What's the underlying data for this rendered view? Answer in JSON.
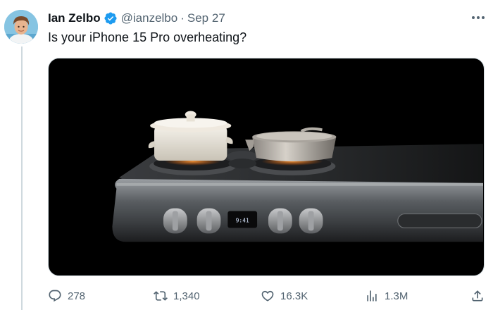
{
  "tweet": {
    "author_name": "Ian Zelbo",
    "handle": "@ianzelbo",
    "separator": "·",
    "date": "Sep 27",
    "text": "Is your iPhone 15 Pro overheating?",
    "verified": true,
    "media": {
      "display_time": "9:41"
    },
    "stats": {
      "replies": "278",
      "retweets": "1,340",
      "likes": "16.3K",
      "views": "1.3M"
    }
  },
  "icons": {
    "avatar": "avatar",
    "verified": "verified-badge-icon",
    "more": "more-icon",
    "reply": "reply-icon",
    "retweet": "retweet-icon",
    "like": "heart-icon",
    "views": "views-icon",
    "share": "share-icon"
  },
  "colors": {
    "verified_badge": "#1d9bf0",
    "secondary_text": "#536471",
    "primary_text": "#0f1419",
    "thread_line": "#cfd9de"
  }
}
